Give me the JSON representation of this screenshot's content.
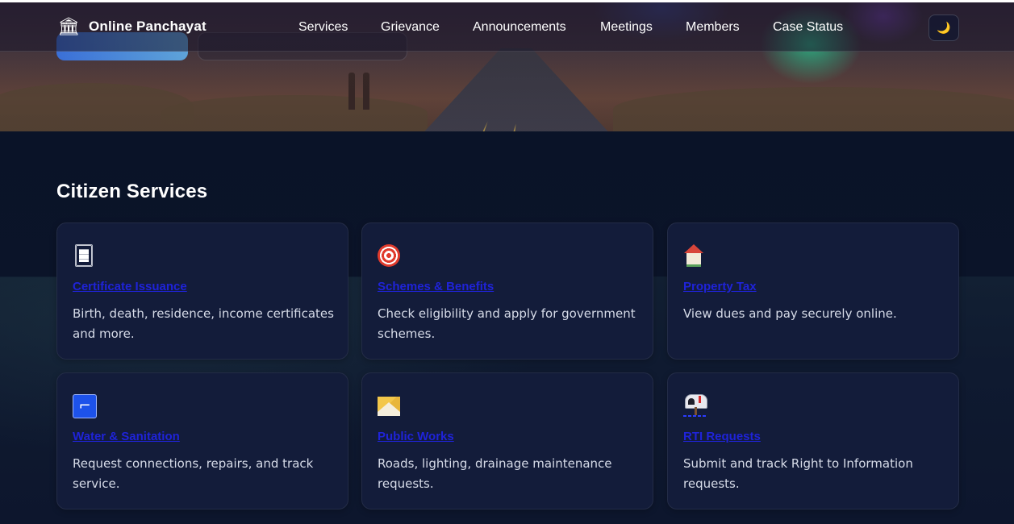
{
  "brand": {
    "title": "Online Panchayat",
    "icon": "building-icon"
  },
  "nav": {
    "items": [
      {
        "label": "Services"
      },
      {
        "label": "Grievance"
      },
      {
        "label": "Announcements"
      },
      {
        "label": "Meetings"
      },
      {
        "label": "Members"
      },
      {
        "label": "Case Status"
      }
    ]
  },
  "theme_toggle": {
    "icon": "moon-icon",
    "glyph": "🌙"
  },
  "services": {
    "title": "Citizen Services",
    "cards": [
      {
        "title": "Certificate Issuance",
        "description": "Birth, death, residence, income certificates and more.",
        "icon": "document-icon"
      },
      {
        "title": "Schemes & Benefits",
        "description": "Check eligibility and apply for government schemes.",
        "icon": "target-icon"
      },
      {
        "title": "Property Tax",
        "description": "View dues and pay securely online.",
        "icon": "house-icon"
      },
      {
        "title": "Water & Sanitation",
        "description": "Request connections, repairs, and track service.",
        "icon": "water-tap-icon"
      },
      {
        "title": "Public Works",
        "description": "Roads, lighting, drainage maintenance requests.",
        "icon": "construction-icon"
      },
      {
        "title": "RTI Requests",
        "description": "Submit and track Right to Information requests.",
        "icon": "mailbox-icon"
      }
    ]
  },
  "colors": {
    "background": "#0b1226",
    "card": "#131c3a",
    "link": "#1f23d8",
    "text": "#d6dbe8"
  }
}
